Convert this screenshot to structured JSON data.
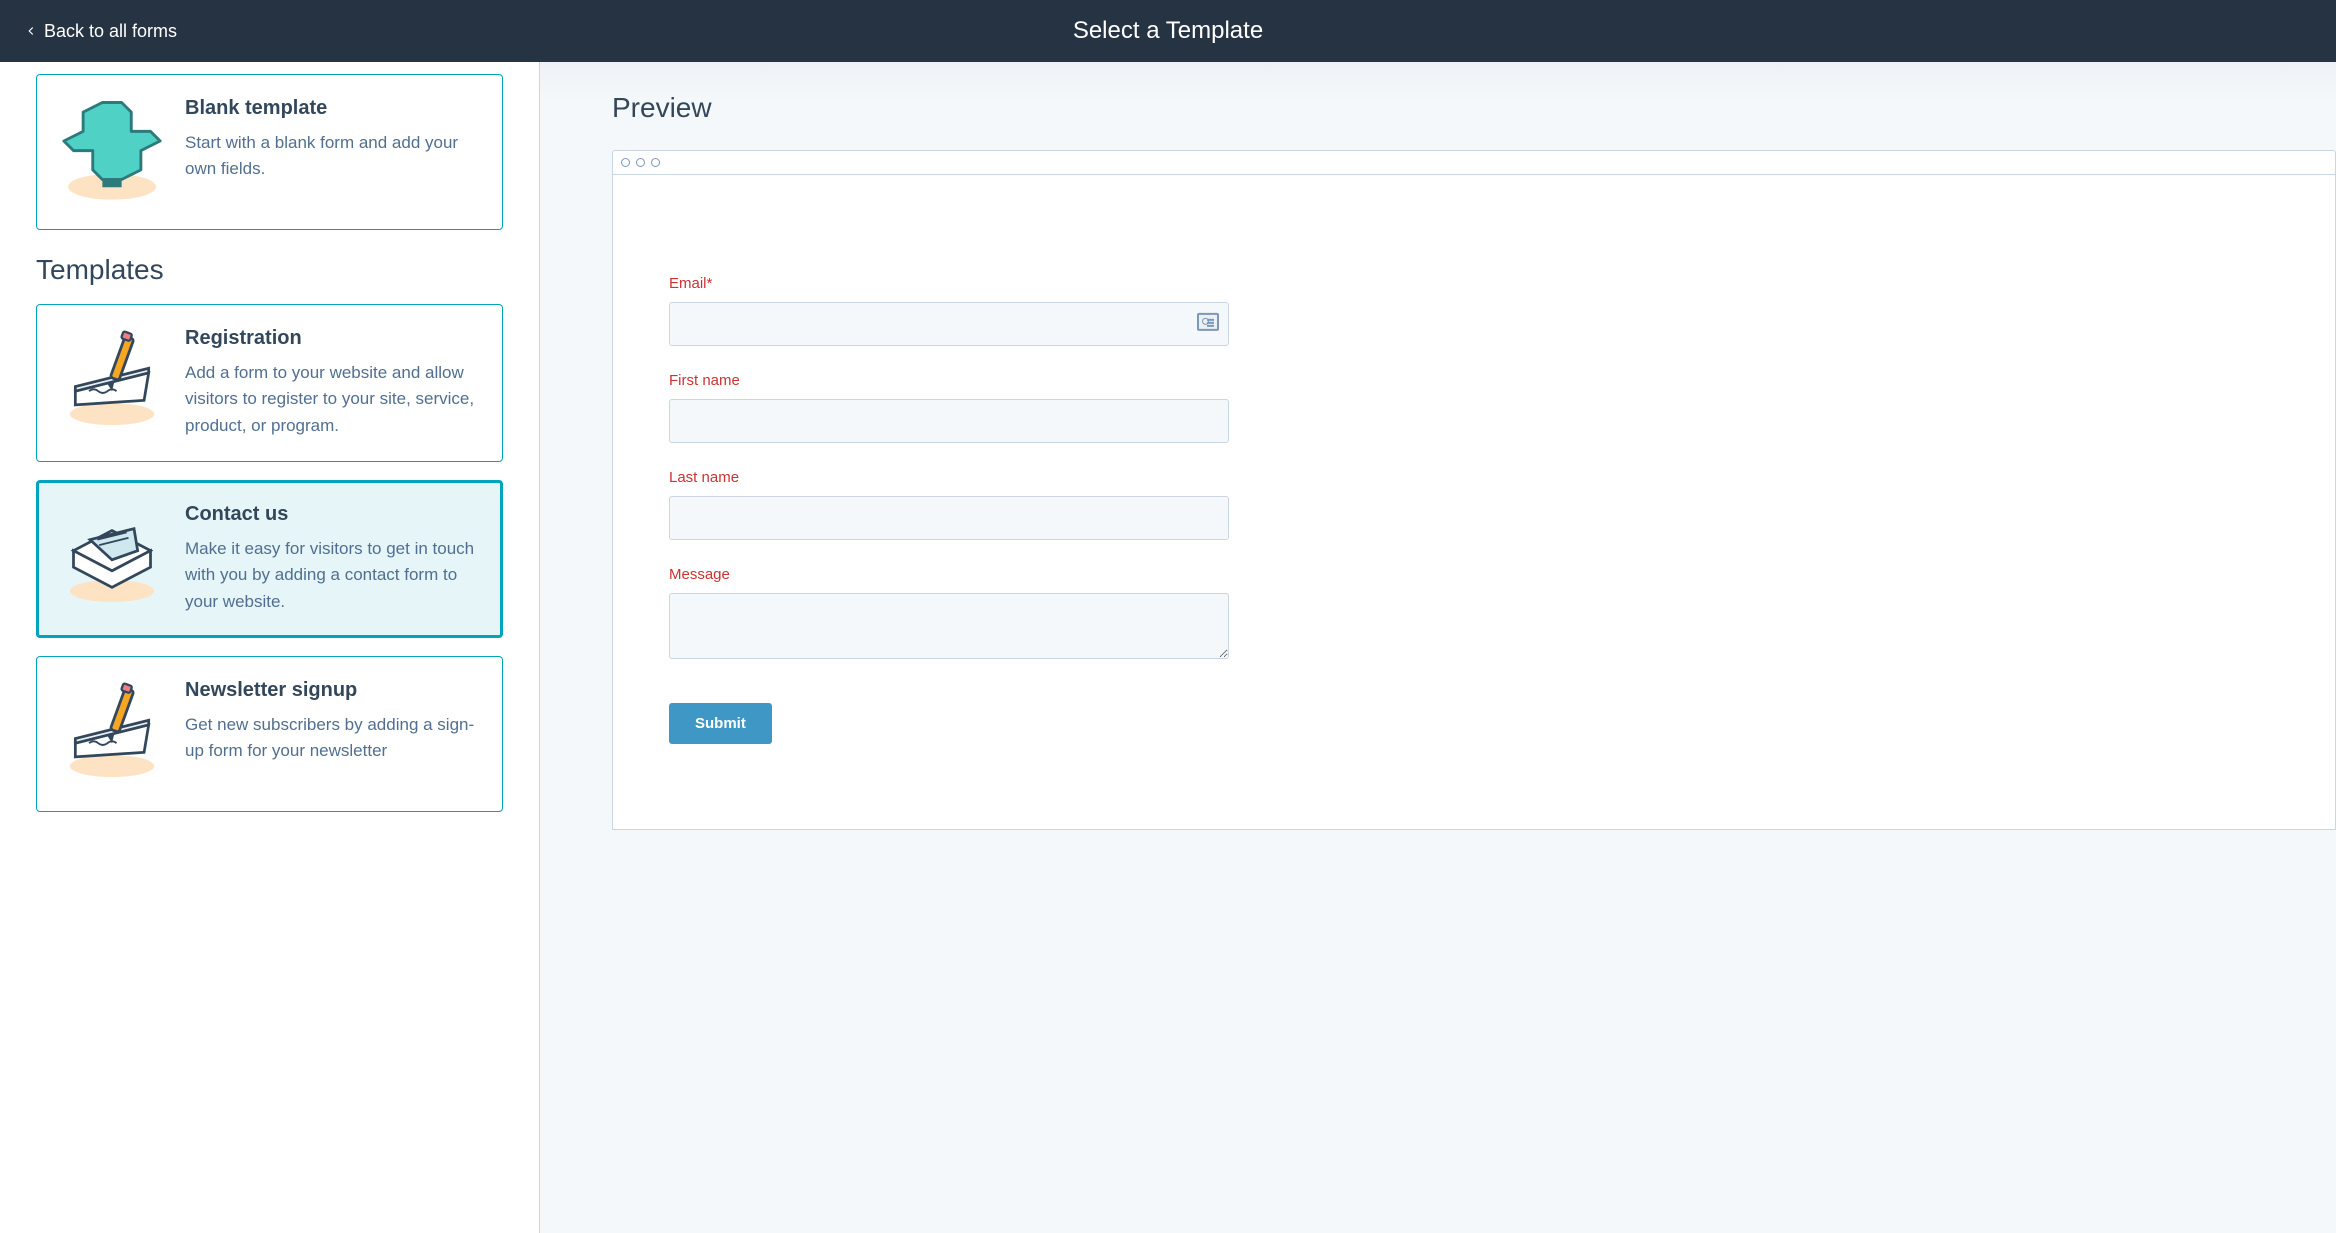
{
  "header": {
    "back_label": "Back to all forms",
    "title": "Select a Template"
  },
  "sidebar": {
    "blank": {
      "title": "Blank template",
      "desc": "Start with a blank form and add your own fields."
    },
    "section_heading": "Templates",
    "templates": [
      {
        "title": "Registration",
        "desc": "Add a form to your website and allow visitors to register to your site, service, product, or program.",
        "selected": false,
        "icon": "pencil-paper"
      },
      {
        "title": "Contact us",
        "desc": "Make it easy for visitors to get in touch with you by adding a contact form to your website.",
        "selected": true,
        "icon": "envelope"
      },
      {
        "title": "Newsletter signup",
        "desc": "Get new subscribers by adding a sign-up form for your newsletter",
        "selected": false,
        "icon": "pencil-paper"
      }
    ]
  },
  "preview": {
    "heading": "Preview",
    "fields": {
      "email_label": "Email*",
      "first_name_label": "First name",
      "last_name_label": "Last name",
      "message_label": "Message"
    },
    "submit_label": "Submit"
  }
}
